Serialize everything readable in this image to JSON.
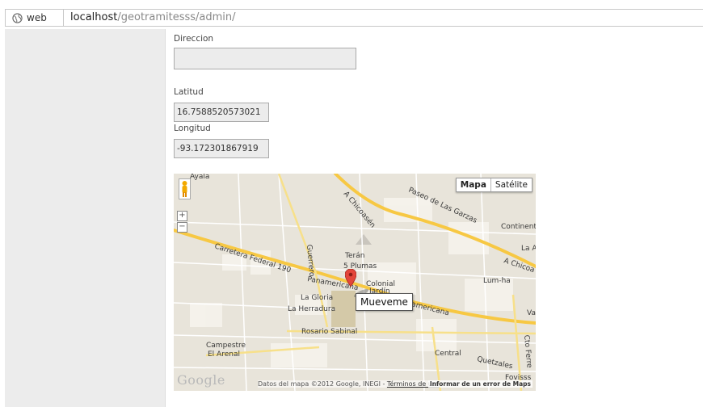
{
  "browser": {
    "site_label": "web",
    "url_host": "localhost",
    "url_path": "/geotramitesss/admin/"
  },
  "form": {
    "direccion_label": "Direccion",
    "direccion_value": "",
    "latitud_label": "Latitud",
    "latitud_value": "16.7588520573021",
    "longitud_label": "Longitud",
    "longitud_value": "-93.172301867919"
  },
  "map": {
    "type_buttons": [
      "Mapa",
      "Satélite"
    ],
    "selected_type": "Mapa",
    "zoom_in": "+",
    "zoom_out": "−",
    "marker_tooltip": "Mueveme",
    "logo": "Google",
    "attribution_text": "Datos del mapa ©2012 Google, INEGI -",
    "terms_link": "Términos de uso",
    "report_link": "Informar de un error de Maps",
    "labels": {
      "ayala": "Ayala",
      "chicoasen_top": "A Chicoasén",
      "paseo_garzas": "Paseo de Las Garzas",
      "continental": "Continental",
      "la_a": "La A",
      "chicoa_right": "A Chicoa",
      "carretera": "Carretera Federal 190",
      "guerrero": "Guerrero",
      "teran": "Terán",
      "cinco_plumas": "5 Plumas",
      "colonial": "Colonial",
      "jardin": "Jardín",
      "panamericana_left": "Panamericana",
      "panamericana_right": "Panamericana",
      "lum_ha": "Lum-ha",
      "la_gloria": "La Gloria",
      "la_herradura": "La Herradura",
      "rosario": "Rosario Sabinal",
      "campestre": "Campestre",
      "el_arenal": "El Arenal",
      "central": "Central",
      "quetzales": "Quetzales",
      "foviss": "Fovisss",
      "va": "Va",
      "cto_fer": "Cto Ferre"
    }
  }
}
